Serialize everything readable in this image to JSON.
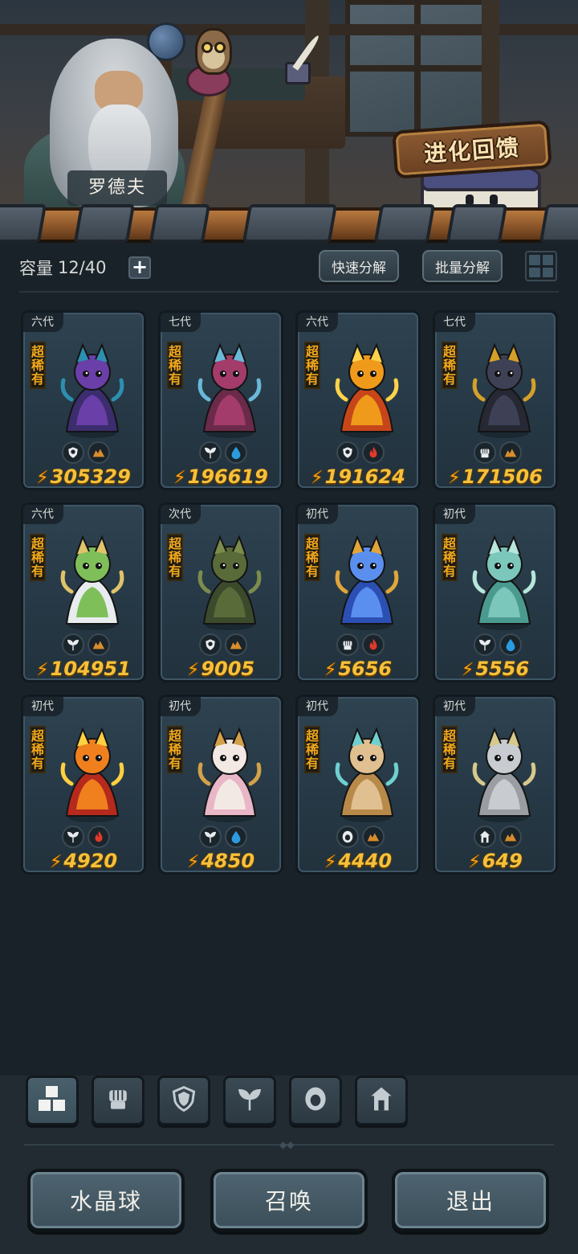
{
  "npc": {
    "name": "罗德夫"
  },
  "evolve_feedback": {
    "label": "进化回馈"
  },
  "inventory": {
    "capacity_label": "容量",
    "capacity_value": "12/40",
    "add_symbol": "+",
    "quick_decompose": "快速分解",
    "batch_decompose": "批量分解"
  },
  "cards": [
    {
      "gen": "六代",
      "rarity": "超稀有",
      "power": "305329",
      "types": [
        "shield-icon",
        "earth-icon"
      ],
      "colors": [
        "#3b2d6e",
        "#6a3fa8",
        "#2d8fb0"
      ]
    },
    {
      "gen": "七代",
      "rarity": "超稀有",
      "power": "196619",
      "types": [
        "leaf-icon",
        "water-icon"
      ],
      "colors": [
        "#6b2a4a",
        "#a33c6a",
        "#6ab8d8"
      ]
    },
    {
      "gen": "六代",
      "rarity": "超稀有",
      "power": "191624",
      "types": [
        "shield-icon",
        "fire-icon"
      ],
      "colors": [
        "#c6461a",
        "#f09a1c",
        "#ffd24a"
      ]
    },
    {
      "gen": "七代",
      "rarity": "超稀有",
      "power": "171506",
      "types": [
        "fist-icon",
        "earth-icon"
      ],
      "colors": [
        "#262833",
        "#3e4155",
        "#d4a02a"
      ]
    },
    {
      "gen": "六代",
      "rarity": "超稀有",
      "power": "104951",
      "types": [
        "leaf-icon",
        "earth-icon"
      ],
      "colors": [
        "#e9ecef",
        "#7fbf5a",
        "#e0c46a"
      ]
    },
    {
      "gen": "次代",
      "rarity": "超稀有",
      "power": "9005",
      "types": [
        "shield-icon",
        "earth-icon"
      ],
      "colors": [
        "#3c4a2c",
        "#5a6b3a",
        "#7c8c4c"
      ]
    },
    {
      "gen": "初代",
      "rarity": "超稀有",
      "power": "5656",
      "types": [
        "fist-icon",
        "fire-icon"
      ],
      "colors": [
        "#2b4fb2",
        "#5a8ff0",
        "#e0a63a"
      ]
    },
    {
      "gen": "初代",
      "rarity": "超稀有",
      "power": "5556",
      "types": [
        "leaf-icon",
        "water-icon"
      ],
      "colors": [
        "#4a9a90",
        "#7cc7bb",
        "#b7e6dc"
      ]
    },
    {
      "gen": "初代",
      "rarity": "超稀有",
      "power": "4920",
      "types": [
        "leaf-icon",
        "fire-icon"
      ],
      "colors": [
        "#b52a1c",
        "#f0801e",
        "#ffd040"
      ]
    },
    {
      "gen": "初代",
      "rarity": "超稀有",
      "power": "4850",
      "types": [
        "leaf-icon",
        "water-icon"
      ],
      "colors": [
        "#e8b6c6",
        "#f3e9e4",
        "#d3a14a"
      ]
    },
    {
      "gen": "初代",
      "rarity": "超稀有",
      "power": "4440",
      "types": [
        "spirit-icon",
        "earth-icon"
      ],
      "colors": [
        "#b88a4a",
        "#e0c090",
        "#6fd0d0"
      ]
    },
    {
      "gen": "初代",
      "rarity": "超稀有",
      "power": "649",
      "types": [
        "tower-icon",
        "earth-icon"
      ],
      "colors": [
        "#9a9ea3",
        "#c8ccd0",
        "#d6c98a"
      ]
    }
  ],
  "filters": [
    "all-icon",
    "fist-icon",
    "shield-icon",
    "leaf-icon",
    "spirit-icon",
    "tower-icon"
  ],
  "buttons": {
    "crystal": "水晶球",
    "summon": "召唤",
    "exit": "退出"
  },
  "colors": {
    "power": "#f6c03b",
    "rarity": "#f3a81a",
    "fire": "#e0392b",
    "water": "#2b9be0",
    "earth": "#d88c2c"
  }
}
